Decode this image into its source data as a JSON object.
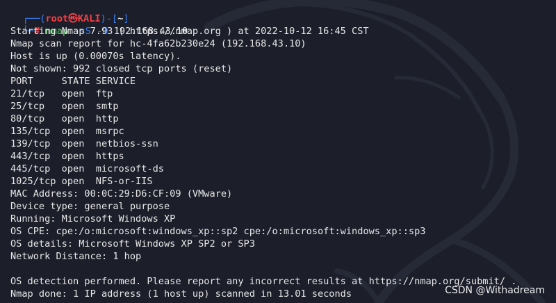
{
  "prompt": {
    "frame_open": "┌──(",
    "user_host": "root㉿KALI",
    "frame_mid": ")-[",
    "cwd": "~",
    "frame_close": "]",
    "frame_bottom": "└─",
    "symbol": "#",
    "command": "nmap",
    "options": "-sS -O",
    "target": "192.168.43.10"
  },
  "output": [
    "Starting Nmap 7.93 ( https://nmap.org ) at 2022-10-12 16:45 CST",
    "Nmap scan report for hc-4fa62b230e24 (192.168.43.10)",
    "Host is up (0.00070s latency).",
    "Not shown: 992 closed tcp ports (reset)",
    "PORT     STATE SERVICE",
    "21/tcp   open  ftp",
    "25/tcp   open  smtp",
    "80/tcp   open  http",
    "135/tcp  open  msrpc",
    "139/tcp  open  netbios-ssn",
    "443/tcp  open  https",
    "445/tcp  open  microsoft-ds",
    "1025/tcp open  NFS-or-IIS",
    "MAC Address: 00:0C:29:D6:CF:09 (VMware)",
    "Device type: general purpose",
    "Running: Microsoft Windows XP",
    "OS CPE: cpe:/o:microsoft:windows_xp::sp2 cpe:/o:microsoft:windows_xp::sp3",
    "OS details: Microsoft Windows XP SP2 or SP3",
    "Network Distance: 1 hop",
    "",
    "OS detection performed. Please report any incorrect results at https://nmap.org/submit/ .",
    "Nmap done: 1 IP address (1 host up) scanned in 13.01 seconds"
  ],
  "watermark": "CSDN @Withadream",
  "colors": {
    "background": "#1c1f2a",
    "text": "#e8e8e8",
    "prompt_frame": "#3d7ff5",
    "prompt_user": "#ff3d44",
    "command": "#4ce15a"
  }
}
